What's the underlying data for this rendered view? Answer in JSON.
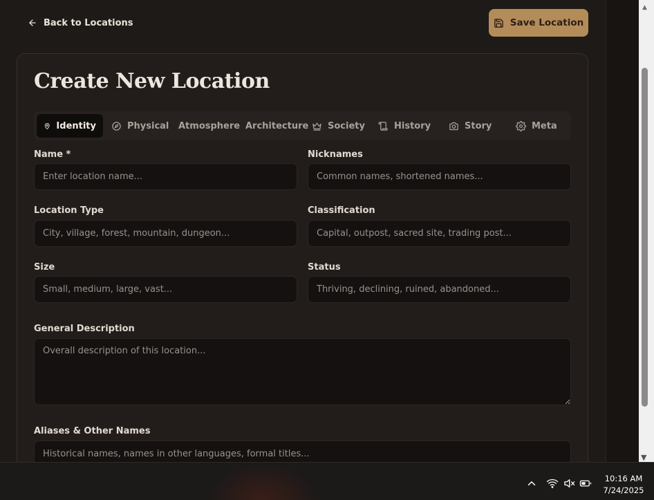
{
  "header": {
    "back_label": "Back to Locations",
    "save_label": "Save Location"
  },
  "page": {
    "title": "Create New Location"
  },
  "tabs": [
    {
      "label": "Identity",
      "icon": "map-pin-icon",
      "active": true
    },
    {
      "label": "Physical",
      "icon": "compass-icon",
      "active": false
    },
    {
      "label": "Atmosphere",
      "icon": "",
      "active": false
    },
    {
      "label": "Architecture",
      "icon": "",
      "active": false
    },
    {
      "label": "Society",
      "icon": "crown-icon",
      "active": false
    },
    {
      "label": "History",
      "icon": "scroll-icon",
      "active": false
    },
    {
      "label": "Story",
      "icon": "camera-icon",
      "active": false
    },
    {
      "label": "Meta",
      "icon": "gear-icon",
      "active": false
    }
  ],
  "form": {
    "name": {
      "label": "Name *",
      "placeholder": "Enter location name...",
      "value": ""
    },
    "nicknames": {
      "label": "Nicknames",
      "placeholder": "Common names, shortened names...",
      "value": ""
    },
    "location_type": {
      "label": "Location Type",
      "placeholder": "City, village, forest, mountain, dungeon...",
      "value": ""
    },
    "classification": {
      "label": "Classification",
      "placeholder": "Capital, outpost, sacred site, trading post...",
      "value": ""
    },
    "size": {
      "label": "Size",
      "placeholder": "Small, medium, large, vast...",
      "value": ""
    },
    "status": {
      "label": "Status",
      "placeholder": "Thriving, declining, ruined, abandoned...",
      "value": ""
    },
    "general_description": {
      "label": "General Description",
      "placeholder": "Overall description of this location...",
      "value": ""
    },
    "aliases": {
      "label": "Aliases & Other Names",
      "placeholder": "Historical names, names in other languages, formal titles...",
      "value": ""
    }
  },
  "taskbar": {
    "time": "10:16 AM",
    "date": "7/24/2025"
  },
  "colors": {
    "background": "#1e1a17",
    "accent": "#b48c5a",
    "input_bg": "#141110",
    "active_tab_bg": "#0f0d0c"
  }
}
